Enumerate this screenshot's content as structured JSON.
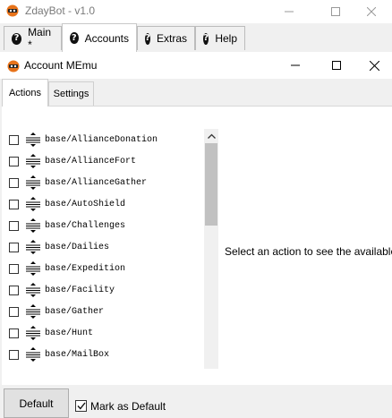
{
  "app": {
    "title": "ZdayBot - v1.0",
    "icon": "bot-logo-icon"
  },
  "main_tabs": [
    {
      "label": "Main *",
      "icon": "question-circle-icon",
      "active": false
    },
    {
      "label": "Accounts",
      "icon": "question-circle-icon",
      "active": true
    },
    {
      "label": "Extras",
      "icon": "question-circle-icon",
      "active": false
    },
    {
      "label": "Help",
      "icon": "question-circle-icon",
      "active": false
    }
  ],
  "dialog": {
    "title": "Account MEmu",
    "icon": "bot-logo-icon"
  },
  "sub_tabs": [
    {
      "label": "Actions",
      "active": true
    },
    {
      "label": "Settings",
      "active": false
    }
  ],
  "actions": [
    {
      "label": "base/AllianceDonation",
      "checked": false
    },
    {
      "label": "base/AllianceFort",
      "checked": false
    },
    {
      "label": "base/AllianceGather",
      "checked": false
    },
    {
      "label": "base/AutoShield",
      "checked": false
    },
    {
      "label": "base/Challenges",
      "checked": false
    },
    {
      "label": "base/Dailies",
      "checked": false
    },
    {
      "label": "base/Expedition",
      "checked": false
    },
    {
      "label": "base/Facility",
      "checked": false
    },
    {
      "label": "base/Gather",
      "checked": false
    },
    {
      "label": "base/Hunt",
      "checked": false
    },
    {
      "label": "base/MailBox",
      "checked": false
    }
  ],
  "detail_message": "Select an action to see the available s",
  "footer": {
    "default_label": "Default",
    "mark_default_label": "Mark as Default",
    "mark_default_checked": true
  },
  "colors": {
    "window_bg": "#f0f0f0",
    "panel_bg": "#ffffff",
    "logo_orange": "#e8731a"
  }
}
